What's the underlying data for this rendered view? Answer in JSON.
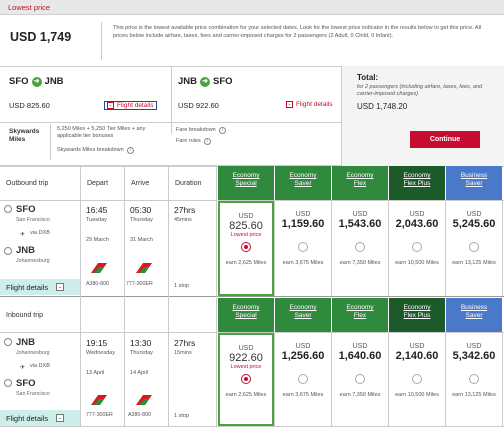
{
  "lowest_price": {
    "label": "Lowest price",
    "amount": "USD 1,749",
    "description": "This price is the lowest available price combination for your selected dates. Look for the lowest price indicator in the results below to get this price. All prices below include airfare, taxes, fees and carrier-imposed charges for 2 passengers (2 Adult, 0 Child, 0 Infant)."
  },
  "summary": {
    "outbound": {
      "from": "SFO",
      "to": "JNB",
      "price": "USD 825.60",
      "details_label": "Flight details"
    },
    "inbound": {
      "from": "JNB",
      "to": "SFO",
      "price": "USD 922.60",
      "details_label": "Flight details"
    },
    "total": {
      "label": "Total:",
      "note": "for 2 passengers (including airfare, taxes, fees, and carrier-imposed charges)",
      "amount": "USD 1,748.20",
      "continue_label": "Continue"
    },
    "skywards": {
      "label": "Skywards Miles",
      "text": "5,250 Miles + 5,250 Tier Miles + any applicable tier bonuses",
      "breakdown_label": "Skywards Miles breakdown"
    },
    "fare_breakdown_label": "Fare breakdown",
    "fare_rules_label": "Fare rules"
  },
  "table": {
    "headers": {
      "outbound": "Outbound trip",
      "inbound": "Inbound trip",
      "depart": "Depart",
      "arrive": "Arrive",
      "duration": "Duration"
    },
    "fare_types": [
      {
        "line1": "Economy",
        "line2": "Special",
        "color": "#2f8a3d"
      },
      {
        "line1": "Economy",
        "line2": "Saver",
        "color": "#2f8a3d"
      },
      {
        "line1": "Economy",
        "line2": "Flex",
        "color": "#2f8a3d"
      },
      {
        "line1": "Economy",
        "line2": "Flex Plus",
        "color": "#1d5a2a"
      },
      {
        "line1": "Business",
        "line2": "Saver",
        "color": "#4a79c9"
      }
    ],
    "outbound": {
      "from_code": "SFO",
      "from_city": "San Francisco",
      "via": "via DXB",
      "to_code": "JNB",
      "to_city": "Johannesburg",
      "depart_time": "16:45",
      "depart_day": "Tuesday",
      "depart_date": "29 March",
      "arrive_time": "05:30",
      "arrive_day": "Thursday",
      "arrive_date": "31 March",
      "duration_h": "27hrs",
      "duration_m": "45mins",
      "stops": "1 stop",
      "aircraft1": "A380-800",
      "aircraft2": "777-300ER",
      "flight_details_label": "Flight details",
      "fares": [
        {
          "currency": "USD",
          "price": "825.60",
          "miles": "earn 2,625 Miles",
          "lowest": "Lowest price",
          "selected": true
        },
        {
          "currency": "USD",
          "price": "1,159.60",
          "miles": "earn 3,675 Miles",
          "selected": false
        },
        {
          "currency": "USD",
          "price": "1,543.60",
          "miles": "earn 7,350 Miles",
          "selected": false
        },
        {
          "currency": "USD",
          "price": "2,043.60",
          "miles": "earn 10,500 Miles",
          "selected": false
        },
        {
          "currency": "USD",
          "price": "5,245.60",
          "miles": "earn 13,125 Miles",
          "selected": false
        }
      ]
    },
    "inbound": {
      "from_code": "JNB",
      "from_city": "Johannesburg",
      "via": "via DXB",
      "to_code": "SFO",
      "to_city": "San Francisco",
      "depart_time": "19:15",
      "depart_day": "Wednesday",
      "depart_date": "13 April",
      "arrive_time": "13:30",
      "arrive_day": "Thursday",
      "arrive_date": "14 April",
      "duration_h": "27hrs",
      "duration_m": "15mins",
      "stops": "1 stop",
      "aircraft1": "777-300ER",
      "aircraft2": "A380-800",
      "flight_details_label": "Flight details",
      "fares": [
        {
          "currency": "USD",
          "price": "922.60",
          "miles": "earn 2,625 Miles",
          "lowest": "Lowest price",
          "selected": true
        },
        {
          "currency": "USD",
          "price": "1,256.60",
          "miles": "earn 3,675 Miles",
          "selected": false
        },
        {
          "currency": "USD",
          "price": "1,640.60",
          "miles": "earn 7,350 Miles",
          "selected": false
        },
        {
          "currency": "USD",
          "price": "2,140.60",
          "miles": "earn 10,500 Miles",
          "selected": false
        },
        {
          "currency": "USD",
          "price": "5,342.60",
          "miles": "earn 13,125 Miles",
          "selected": false
        }
      ]
    }
  }
}
